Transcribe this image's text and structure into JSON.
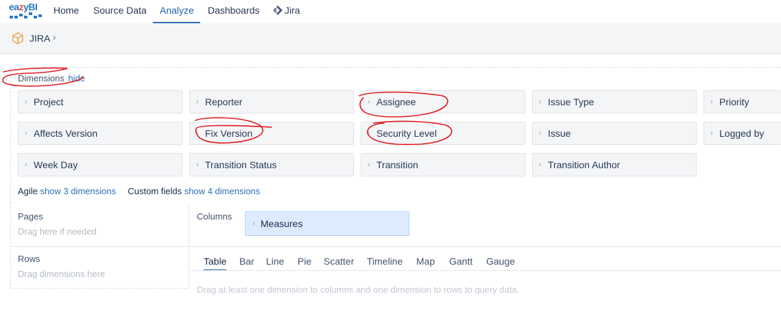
{
  "nav": {
    "logo": {
      "part1": "ea",
      "part2": "z",
      "part3": "yBI"
    },
    "items": [
      "Home",
      "Source Data",
      "Analyze",
      "Dashboards"
    ],
    "active": "Analyze",
    "jira_label": "Jira"
  },
  "breadcrumb": {
    "label": "JIRA"
  },
  "dimensions": {
    "title": "Dimensions",
    "hide_link": "hide",
    "items": [
      "Project",
      "Reporter",
      "Assignee",
      "Issue Type",
      "Priority",
      "Affects Version",
      "Fix Version",
      "Security Level",
      "Issue",
      "Logged by",
      "Week Day",
      "Transition Status",
      "Transition",
      "Transition Author"
    ],
    "agile_label": "Agile",
    "agile_link": "show 3 dimensions",
    "custom_label": "Custom fields",
    "custom_link": "show 4 dimensions"
  },
  "pages": {
    "title": "Pages",
    "hint": "Drag here if needed"
  },
  "rows": {
    "title": "Rows",
    "hint": "Drag dimensions here"
  },
  "columns": {
    "title": "Columns",
    "measures_label": "Measures"
  },
  "view_tabs": [
    "Table",
    "Bar",
    "Line",
    "Pie",
    "Scatter",
    "Timeline",
    "Map",
    "Gantt",
    "Gauge"
  ],
  "active_view_tab": "Table",
  "empty_message": "Drag at least one dimension to columns and one dimension to rows to query data.",
  "colors": {
    "accent": "#2d6fb6",
    "annotation": "#e0191e",
    "button_bg": "#f4f5f7",
    "measures_bg": "#deebff"
  }
}
